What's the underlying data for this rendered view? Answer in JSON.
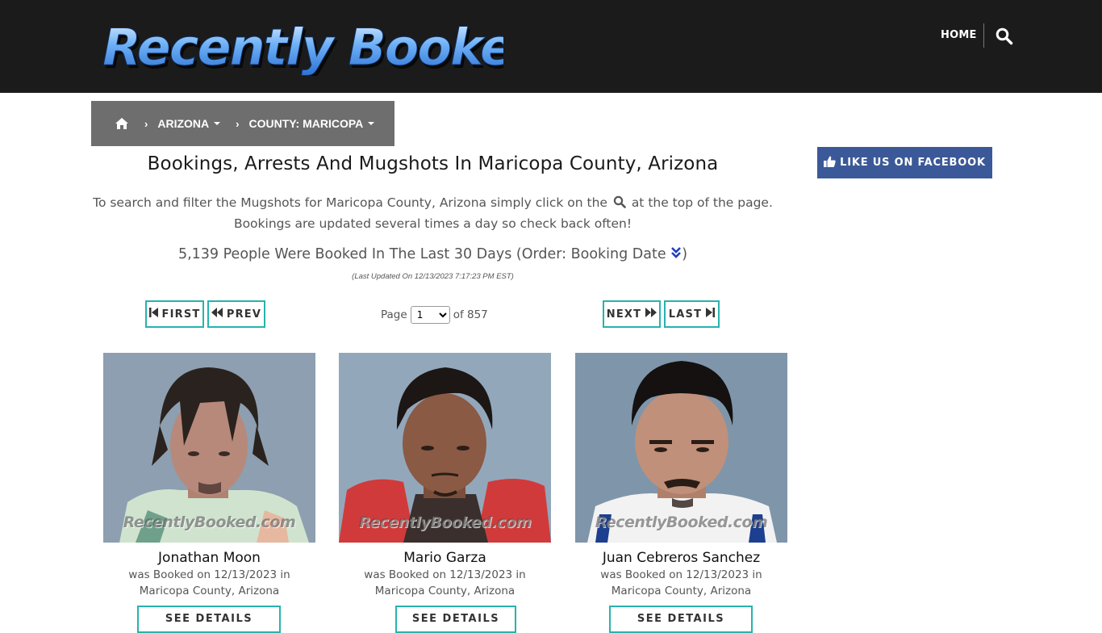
{
  "header": {
    "logo_text": "Recently Booked",
    "nav": {
      "home_label": "HOME",
      "search_icon": "search-icon"
    }
  },
  "breadcrumb": {
    "home_icon": "home-icon",
    "items": [
      {
        "label": "ARIZONA"
      },
      {
        "label": "COUNTY: MARICOPA"
      }
    ]
  },
  "main": {
    "title": "Bookings, Arrests And Mugshots In Maricopa County, Arizona",
    "intro_part1": "To search and filter the Mugshots for Maricopa County, Arizona simply click on the",
    "intro_part2": "at the top of the page.",
    "intro_line2": "Bookings are updated several times a day so check back often!",
    "count_text": "5,139 People Were Booked In The Last 30 Days (Order: Booking Date",
    "count_close": ")",
    "last_updated": "(Last Updated On 12/13/2023 7:17:23 PM EST)"
  },
  "pager": {
    "first_label": "FIRST",
    "prev_label": "PREV",
    "next_label": "NEXT",
    "last_label": "LAST",
    "page_prefix": "Page",
    "page_value": "1",
    "page_suffix": "of 857"
  },
  "cards": [
    {
      "name": "Jonathan Moon",
      "booked_line1": "was Booked on 12/13/2023 in",
      "booked_line2": "Maricopa County, Arizona",
      "watermark": "RecentlyBooked.com",
      "details_label": "SEE DETAILS"
    },
    {
      "name": "Mario Garza",
      "booked_line1": "was Booked on 12/13/2023 in",
      "booked_line2": "Maricopa County, Arizona",
      "watermark": "RecentlyBooked.com",
      "details_label": "SEE DETAILS"
    },
    {
      "name": "Juan Cebreros Sanchez",
      "booked_line1": "was Booked on 12/13/2023 in",
      "booked_line2": "Maricopa County, Arizona",
      "watermark": "RecentlyBooked.com",
      "details_label": "SEE DETAILS"
    }
  ],
  "sidebar": {
    "facebook_label": "LIKE US ON FACEBOOK"
  },
  "colors": {
    "header_bg": "#1b1b1b",
    "breadcrumb_bg": "#6e6e6e",
    "accent_teal": "#27b3ad",
    "facebook_blue": "#3b5998",
    "order_icon_blue": "#1e3fbf"
  }
}
